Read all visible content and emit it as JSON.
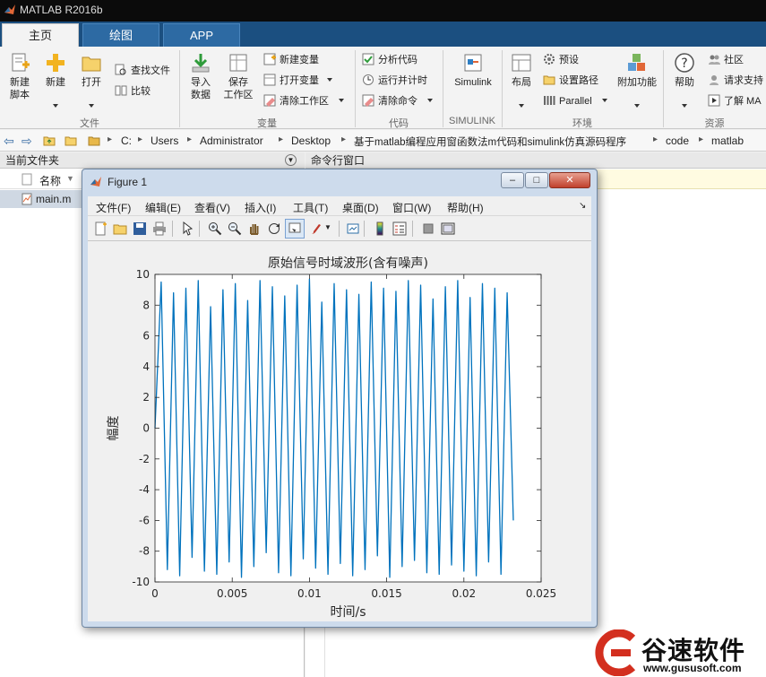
{
  "window": {
    "title": "MATLAB R2016b"
  },
  "tabs": [
    {
      "label": "主页"
    },
    {
      "label": "绘图"
    },
    {
      "label": "APP"
    }
  ],
  "ribbon": {
    "file": {
      "group_label": "文件",
      "new_script": "新建\n脚本",
      "new": "新建",
      "open": "打开",
      "find_files": "查找文件",
      "compare": "比较"
    },
    "variable": {
      "group_label": "变量",
      "import_data": "导入\n数据",
      "save_workspace": "保存\n工作区",
      "new_variable": "新建变量",
      "open_variable": "打开变量",
      "clear_workspace": "清除工作区"
    },
    "code": {
      "group_label": "代码",
      "analyze_code": "分析代码",
      "run_and_time": "运行并计时",
      "clear_commands": "清除命令"
    },
    "simulink": {
      "group_label": "SIMULINK",
      "simulink": "Simulink"
    },
    "environment": {
      "group_label": "环境",
      "layout": "布局",
      "preferences": "预设",
      "set_path": "设置路径",
      "parallel": "Parallel",
      "addons": "附加功能"
    },
    "resources": {
      "group_label": "资源",
      "help": "帮助",
      "community": "社区",
      "request_support": "请求支持",
      "learn_matlab": "了解 MA"
    }
  },
  "address": {
    "crumbs": [
      "C:",
      "Users",
      "Administrator",
      "Desktop",
      "基于matlab编程应用窗函数法m代码和simulink仿真源码程序",
      "code",
      "matlab"
    ]
  },
  "current_folder": {
    "title": "当前文件夹",
    "column_name": "名称",
    "files": [
      "main.m"
    ]
  },
  "command_window": {
    "title": "命令行窗口"
  },
  "figure": {
    "title": "Figure 1",
    "menu": [
      "文件(F)",
      "编辑(E)",
      "查看(V)",
      "插入(I)",
      "工具(T)",
      "桌面(D)",
      "窗口(W)",
      "帮助(H)"
    ]
  },
  "chart_data": {
    "type": "line",
    "title": "原始信号时域波形(含有噪声)",
    "xlabel": "时间/s",
    "ylabel": "幅度",
    "xlim": [
      0,
      0.025
    ],
    "ylim": [
      -10,
      10
    ],
    "xticks": [
      "0",
      "0.005",
      "0.01",
      "0.015",
      "0.02",
      "0.025"
    ],
    "yticks": [
      "-10",
      "-8",
      "-6",
      "-4",
      "-2",
      "0",
      "2",
      "4",
      "6",
      "8",
      "10"
    ],
    "grid": false,
    "series": [
      {
        "color": "#0072bd",
        "x_range": [
          0,
          0.0232
        ],
        "y_range": [
          -9.7,
          9.7
        ],
        "x": [
          0,
          0.0004,
          0.0008,
          0.0012,
          0.0016,
          0.002,
          0.0024,
          0.0028,
          0.0032,
          0.0036,
          0.004,
          0.0044,
          0.0048,
          0.0052,
          0.0056,
          0.006,
          0.0064,
          0.0068,
          0.0072,
          0.0076,
          0.008,
          0.0084,
          0.0088,
          0.0092,
          0.0096,
          0.01,
          0.0104,
          0.0108,
          0.0112,
          0.0116,
          0.012,
          0.0124,
          0.0128,
          0.0132,
          0.0136,
          0.014,
          0.0144,
          0.0148,
          0.0152,
          0.0156,
          0.016,
          0.0164,
          0.0168,
          0.0172,
          0.0176,
          0.018,
          0.0184,
          0.0188,
          0.0192,
          0.0196,
          0.02,
          0.0204,
          0.0208,
          0.0212,
          0.0216,
          0.022,
          0.0224,
          0.0228,
          0.0232
        ],
        "y": [
          0,
          9.5,
          -9.2,
          8.8,
          -9.6,
          9.1,
          -8.4,
          9.6,
          -9.3,
          7.9,
          -9.5,
          9.0,
          -8.7,
          9.4,
          -9.7,
          8.3,
          -9.0,
          9.6,
          -8.1,
          9.2,
          -9.4,
          8.6,
          -9.6,
          9.3,
          -8.5,
          9.7,
          -9.1,
          8.2,
          -9.5,
          9.4,
          -8.8,
          9.0,
          -9.6,
          8.7,
          -9.2,
          9.5,
          -8.3,
          9.1,
          -9.7,
          8.9,
          -9.0,
          9.6,
          -8.6,
          9.3,
          -9.4,
          8.4,
          -9.5,
          9.2,
          -8.9,
          9.6,
          -9.3,
          8.5,
          -9.6,
          9.4,
          -8.7,
          9.1,
          -9.5,
          8.8,
          -6.0
        ]
      }
    ]
  },
  "watermark": {
    "brand": "谷速软件",
    "url": "www.gususoft.com"
  }
}
